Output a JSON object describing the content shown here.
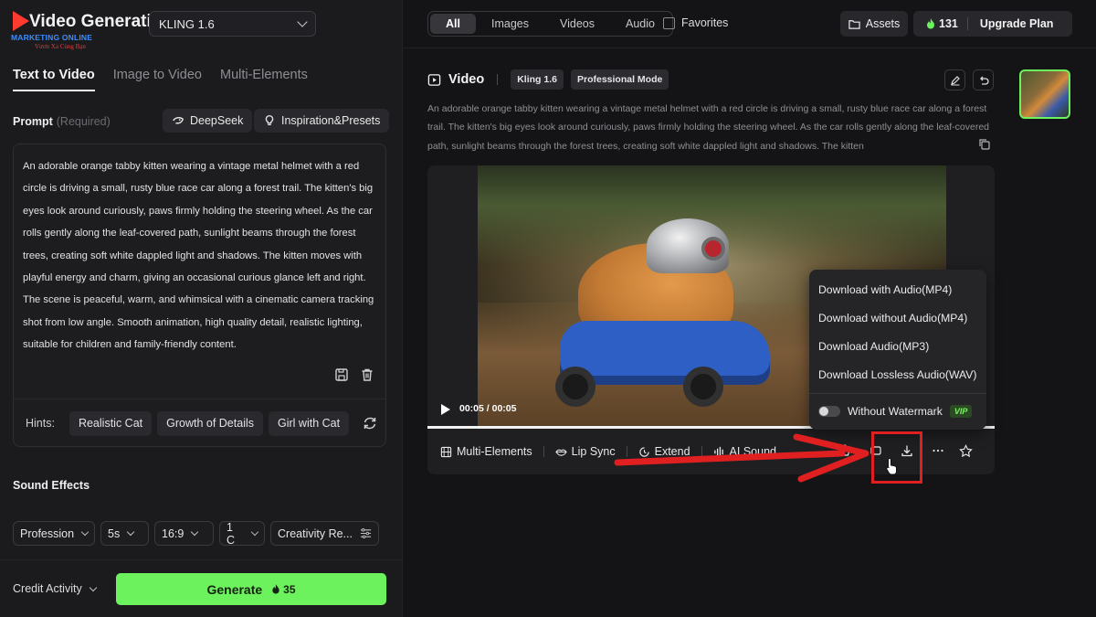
{
  "brand": {
    "title": "Video Generation",
    "sub1": "MARKETING ONLINE",
    "sub2": "Vươn Xa Cùng Bạn"
  },
  "model_select": {
    "value": "KLING 1.6"
  },
  "mode_tabs": [
    {
      "label": "Text to Video",
      "active": true
    },
    {
      "label": "Image to Video",
      "active": false
    },
    {
      "label": "Multi-Elements",
      "active": false
    }
  ],
  "prompt": {
    "label": "Prompt",
    "required": "(Required)",
    "deepseek_label": "DeepSeek",
    "inspiration_label": "Inspiration&Presets",
    "text": "An adorable orange tabby kitten wearing a vintage metal helmet with a red circle is driving a small, rusty blue race car along a forest trail. The kitten's big eyes look around curiously, paws firmly holding the steering wheel. As the car rolls gently along the leaf-covered path, sunlight beams through the forest trees, creating soft white dappled light and shadows. The kitten moves with playful energy and charm, giving an occasional curious glance left and right. The scene is peaceful, warm, and whimsical with a cinematic camera tracking shot from low angle. Smooth animation, high quality detail, realistic lighting, suitable for children and family-friendly content."
  },
  "hints": {
    "label": "Hints:",
    "chips": [
      "Realistic Cat",
      "Growth of Details",
      "Girl with Cat"
    ]
  },
  "sound_effects": {
    "label": "Sound Effects"
  },
  "settings": {
    "mode": "Profession",
    "duration": "5s",
    "ratio": "16:9",
    "count": "1 C",
    "creativity": "Creativity Re..."
  },
  "bottom": {
    "credit_activity": "Credit Activity",
    "generate_label": "Generate",
    "generate_cost": "35"
  },
  "topbar": {
    "filters": [
      {
        "label": "All",
        "active": true
      },
      {
        "label": "Images",
        "active": false
      },
      {
        "label": "Videos",
        "active": false
      },
      {
        "label": "Audio",
        "active": false
      }
    ],
    "favorites": "Favorites",
    "assets": "Assets",
    "credits": "131",
    "upgrade": "Upgrade Plan"
  },
  "video": {
    "title": "Video",
    "tags": [
      "Kling 1.6",
      "Professional Mode"
    ],
    "description": "An adorable orange tabby kitten wearing a vintage metal helmet with a red circle is driving a small, rusty blue race car along a forest trail. The kitten's big eyes look around curiously, paws firmly holding the steering wheel. As the car rolls gently along the leaf-covered path, sunlight beams through the forest trees, creating soft white dappled light and shadows. The kitten",
    "time": "00:05 / 00:05",
    "progress": 1.0
  },
  "toolbar": {
    "multi_elements": "Multi-Elements",
    "lip_sync": "Lip Sync",
    "extend": "Extend",
    "ai_sound": "AI Sound"
  },
  "download_menu": {
    "items": [
      "Download with Audio(MP4)",
      "Download without Audio(MP4)",
      "Download Audio(MP3)",
      "Download Lossless Audio(WAV)"
    ],
    "watermark": "Without Watermark",
    "vip": "VIP"
  },
  "colors": {
    "accent_green": "#6cf25d",
    "annotation_red": "#e02020"
  }
}
